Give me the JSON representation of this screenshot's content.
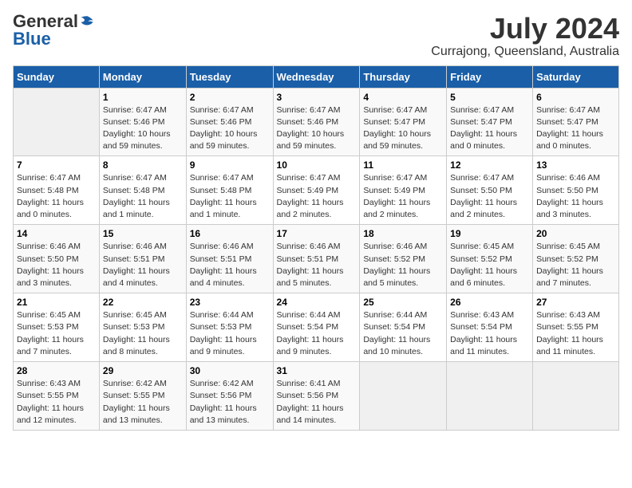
{
  "logo": {
    "general": "General",
    "blue": "Blue"
  },
  "title": "July 2024",
  "subtitle": "Currajong, Queensland, Australia",
  "days_header": [
    "Sunday",
    "Monday",
    "Tuesday",
    "Wednesday",
    "Thursday",
    "Friday",
    "Saturday"
  ],
  "weeks": [
    [
      {
        "day": "",
        "info": ""
      },
      {
        "day": "1",
        "info": "Sunrise: 6:47 AM\nSunset: 5:46 PM\nDaylight: 10 hours\nand 59 minutes."
      },
      {
        "day": "2",
        "info": "Sunrise: 6:47 AM\nSunset: 5:46 PM\nDaylight: 10 hours\nand 59 minutes."
      },
      {
        "day": "3",
        "info": "Sunrise: 6:47 AM\nSunset: 5:46 PM\nDaylight: 10 hours\nand 59 minutes."
      },
      {
        "day": "4",
        "info": "Sunrise: 6:47 AM\nSunset: 5:47 PM\nDaylight: 10 hours\nand 59 minutes."
      },
      {
        "day": "5",
        "info": "Sunrise: 6:47 AM\nSunset: 5:47 PM\nDaylight: 11 hours\nand 0 minutes."
      },
      {
        "day": "6",
        "info": "Sunrise: 6:47 AM\nSunset: 5:47 PM\nDaylight: 11 hours\nand 0 minutes."
      }
    ],
    [
      {
        "day": "7",
        "info": "Sunrise: 6:47 AM\nSunset: 5:48 PM\nDaylight: 11 hours\nand 0 minutes."
      },
      {
        "day": "8",
        "info": "Sunrise: 6:47 AM\nSunset: 5:48 PM\nDaylight: 11 hours\nand 1 minute."
      },
      {
        "day": "9",
        "info": "Sunrise: 6:47 AM\nSunset: 5:48 PM\nDaylight: 11 hours\nand 1 minute."
      },
      {
        "day": "10",
        "info": "Sunrise: 6:47 AM\nSunset: 5:49 PM\nDaylight: 11 hours\nand 2 minutes."
      },
      {
        "day": "11",
        "info": "Sunrise: 6:47 AM\nSunset: 5:49 PM\nDaylight: 11 hours\nand 2 minutes."
      },
      {
        "day": "12",
        "info": "Sunrise: 6:47 AM\nSunset: 5:50 PM\nDaylight: 11 hours\nand 2 minutes."
      },
      {
        "day": "13",
        "info": "Sunrise: 6:46 AM\nSunset: 5:50 PM\nDaylight: 11 hours\nand 3 minutes."
      }
    ],
    [
      {
        "day": "14",
        "info": "Sunrise: 6:46 AM\nSunset: 5:50 PM\nDaylight: 11 hours\nand 3 minutes."
      },
      {
        "day": "15",
        "info": "Sunrise: 6:46 AM\nSunset: 5:51 PM\nDaylight: 11 hours\nand 4 minutes."
      },
      {
        "day": "16",
        "info": "Sunrise: 6:46 AM\nSunset: 5:51 PM\nDaylight: 11 hours\nand 4 minutes."
      },
      {
        "day": "17",
        "info": "Sunrise: 6:46 AM\nSunset: 5:51 PM\nDaylight: 11 hours\nand 5 minutes."
      },
      {
        "day": "18",
        "info": "Sunrise: 6:46 AM\nSunset: 5:52 PM\nDaylight: 11 hours\nand 5 minutes."
      },
      {
        "day": "19",
        "info": "Sunrise: 6:45 AM\nSunset: 5:52 PM\nDaylight: 11 hours\nand 6 minutes."
      },
      {
        "day": "20",
        "info": "Sunrise: 6:45 AM\nSunset: 5:52 PM\nDaylight: 11 hours\nand 7 minutes."
      }
    ],
    [
      {
        "day": "21",
        "info": "Sunrise: 6:45 AM\nSunset: 5:53 PM\nDaylight: 11 hours\nand 7 minutes."
      },
      {
        "day": "22",
        "info": "Sunrise: 6:45 AM\nSunset: 5:53 PM\nDaylight: 11 hours\nand 8 minutes."
      },
      {
        "day": "23",
        "info": "Sunrise: 6:44 AM\nSunset: 5:53 PM\nDaylight: 11 hours\nand 9 minutes."
      },
      {
        "day": "24",
        "info": "Sunrise: 6:44 AM\nSunset: 5:54 PM\nDaylight: 11 hours\nand 9 minutes."
      },
      {
        "day": "25",
        "info": "Sunrise: 6:44 AM\nSunset: 5:54 PM\nDaylight: 11 hours\nand 10 minutes."
      },
      {
        "day": "26",
        "info": "Sunrise: 6:43 AM\nSunset: 5:54 PM\nDaylight: 11 hours\nand 11 minutes."
      },
      {
        "day": "27",
        "info": "Sunrise: 6:43 AM\nSunset: 5:55 PM\nDaylight: 11 hours\nand 11 minutes."
      }
    ],
    [
      {
        "day": "28",
        "info": "Sunrise: 6:43 AM\nSunset: 5:55 PM\nDaylight: 11 hours\nand 12 minutes."
      },
      {
        "day": "29",
        "info": "Sunrise: 6:42 AM\nSunset: 5:55 PM\nDaylight: 11 hours\nand 13 minutes."
      },
      {
        "day": "30",
        "info": "Sunrise: 6:42 AM\nSunset: 5:56 PM\nDaylight: 11 hours\nand 13 minutes."
      },
      {
        "day": "31",
        "info": "Sunrise: 6:41 AM\nSunset: 5:56 PM\nDaylight: 11 hours\nand 14 minutes."
      },
      {
        "day": "",
        "info": ""
      },
      {
        "day": "",
        "info": ""
      },
      {
        "day": "",
        "info": ""
      }
    ]
  ]
}
